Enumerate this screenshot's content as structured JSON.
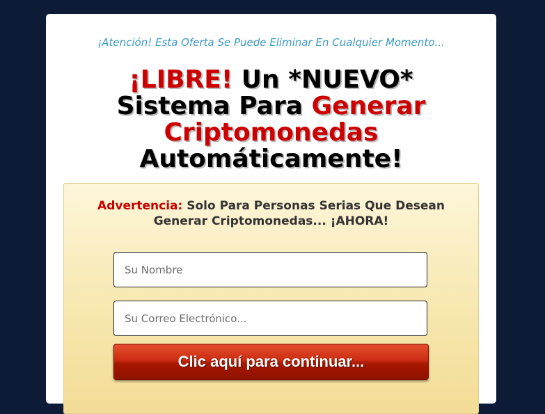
{
  "banner": {
    "attention": "¡Atención! Esta Oferta Se Puede Eliminar En Cualquier Momento..."
  },
  "headline": {
    "line1_red": "¡LIBRE!",
    "line1_rest": " Un *NUEVO*",
    "line2_black": "Sistema Para ",
    "line2_red": "Generar",
    "line3_red": "Criptomonedas",
    "line4": "Automáticamente!"
  },
  "form": {
    "warning_label": "Advertencia:",
    "warning_text": " Solo Para Personas Serias Que Desean Generar Criptomonedas... ¡AHORA!",
    "name_placeholder": "Su Nombre",
    "email_placeholder": "Su Correo Electrónico...",
    "submit_label": "Clic aquí para continuar..."
  },
  "colors": {
    "page_background": "#0e1b36",
    "accent_red": "#cc0000",
    "attention_blue": "#3a9bc4",
    "panel_gold": "#f7e6ac"
  }
}
